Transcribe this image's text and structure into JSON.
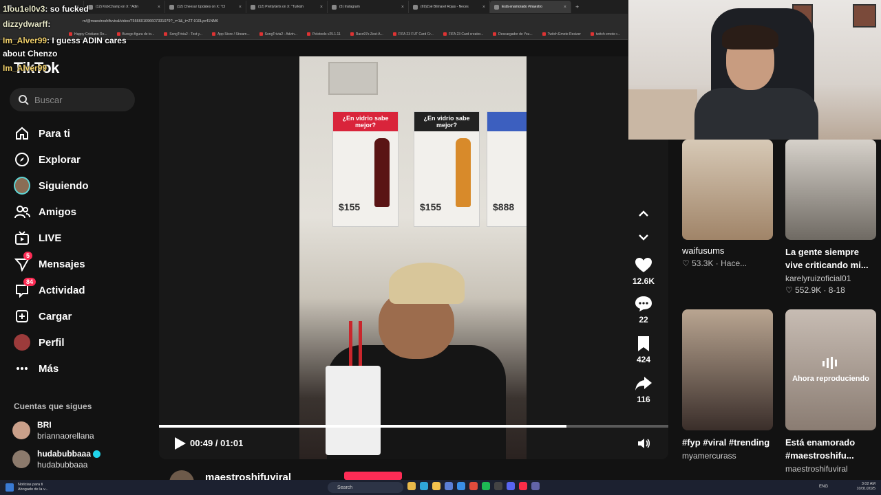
{
  "browser": {
    "tabs": [
      {
        "label": "",
        "active": false
      },
      {
        "label": "(12) KickChamp on X: \"Adin",
        "active": false
      },
      {
        "label": "(12) Cheesur Updates on X: \"Cl",
        "active": false
      },
      {
        "label": "(12) PrettyGirls on X: \"Turkish",
        "active": false
      },
      {
        "label": "(5) Instagram",
        "active": false
      },
      {
        "label": "(69)Zoé Bilmarel Rojas - Neces",
        "active": false
      },
      {
        "label": "Está enamorado #maestro",
        "active": true
      }
    ],
    "url": "m/@maestroshifuviral/video/7566601096607331079?_r=1&_t=ZT-910Lye41NM6",
    "bookmarks": [
      "Happy Cristiano Ro...",
      "Burego figura de to...",
      "SongTrivia2 - Test y...",
      "App Store / Stream...",
      "SongTrivia2 - Advin...",
      "Peletools v25.1.11",
      "Raco97s Zest-A...",
      "FIFA 23 FUT Card Cr...",
      "FIFA 23 Card creator...",
      "Descargador de You...",
      "Twitch Emote Resizer",
      "twitch emote r..."
    ]
  },
  "chat": [
    {
      "user": "1lou1el0v3",
      "msg": ": so fucked"
    },
    {
      "user": "dizzydwarff",
      "msg": ":"
    },
    {
      "user": "Im_Alver99",
      "msg": ": I guess ADIN cares"
    },
    {
      "user": "",
      "msg": "about Chenzo"
    },
    {
      "user": "Im_Alver99",
      "msg": ""
    }
  ],
  "sidebar": {
    "logo": "TikTok",
    "search_placeholder": "Buscar",
    "items": [
      {
        "label": "Para ti",
        "icon": "home-icon"
      },
      {
        "label": "Explorar",
        "icon": "compass-icon"
      },
      {
        "label": "Siguiendo",
        "icon": "following-avatar"
      },
      {
        "label": "Amigos",
        "icon": "friends-icon"
      },
      {
        "label": "LIVE",
        "icon": "live-tv-icon"
      },
      {
        "label": "Mensajes",
        "icon": "send-icon",
        "badge": "5"
      },
      {
        "label": "Actividad",
        "icon": "inbox-icon",
        "badge": "84"
      },
      {
        "label": "Cargar",
        "icon": "upload-plus-icon"
      },
      {
        "label": "Perfil",
        "icon": "profile-avatar"
      },
      {
        "label": "Más",
        "icon": "more-icon"
      }
    ],
    "following_title": "Cuentas que sigues",
    "following": [
      {
        "name": "BRI",
        "handle": "briannaorellana",
        "verified": false
      },
      {
        "name": "hudabubbaaa",
        "handle": "hudabubbaaa",
        "verified": true
      }
    ]
  },
  "video": {
    "posters": [
      {
        "title": "¿En vidrio sabe mejor?",
        "price": "$155",
        "head_color": "#d9243b",
        "bottle_color": "#5a1414"
      },
      {
        "title": "¿En vidrio sabe mejor?",
        "price": "$155",
        "head_color": "#222222",
        "bottle_color": "#d88a2a"
      },
      {
        "title": "",
        "price": "$888",
        "head_color": "#3c5fbf",
        "bottle_color": "#3a5fa0"
      }
    ],
    "time": "00:49 / 01:01",
    "progress": 0.8,
    "author": "maestroshifuviral"
  },
  "actions": {
    "likes": "12.6K",
    "comments": "22",
    "saves": "424",
    "shares": "116"
  },
  "recommended": [
    {
      "caption": "waifusums",
      "meta": "♡ 53.3K · Hace...",
      "bold": false,
      "colors": [
        "#d7c9b6",
        "#a08468"
      ]
    },
    {
      "caption": "La gente siempre vive criticando mi...",
      "meta": "karelyruizoficial01",
      "meta2": "♡ 552.9K · 8-18",
      "bold": true,
      "colors": [
        "#d6d1ca",
        "#6f6a63"
      ]
    },
    {
      "caption": "#fyp #viral #trending",
      "meta": "myamercurass",
      "bold": true,
      "colors": [
        "#b9a591",
        "#3a2e2a"
      ]
    },
    {
      "caption": "Está enamorado #maestroshifu...",
      "meta": "maestroshifuviral",
      "bold": true,
      "now_playing": "Ahora reproduciendo"
    }
  ],
  "taskbar": {
    "notification_title": "Noticias para ti",
    "notification_sub": "Abogado de la v...",
    "search": "Search",
    "lang": "ENG",
    "time": "3:02 AM",
    "date": "10/31/2025"
  }
}
